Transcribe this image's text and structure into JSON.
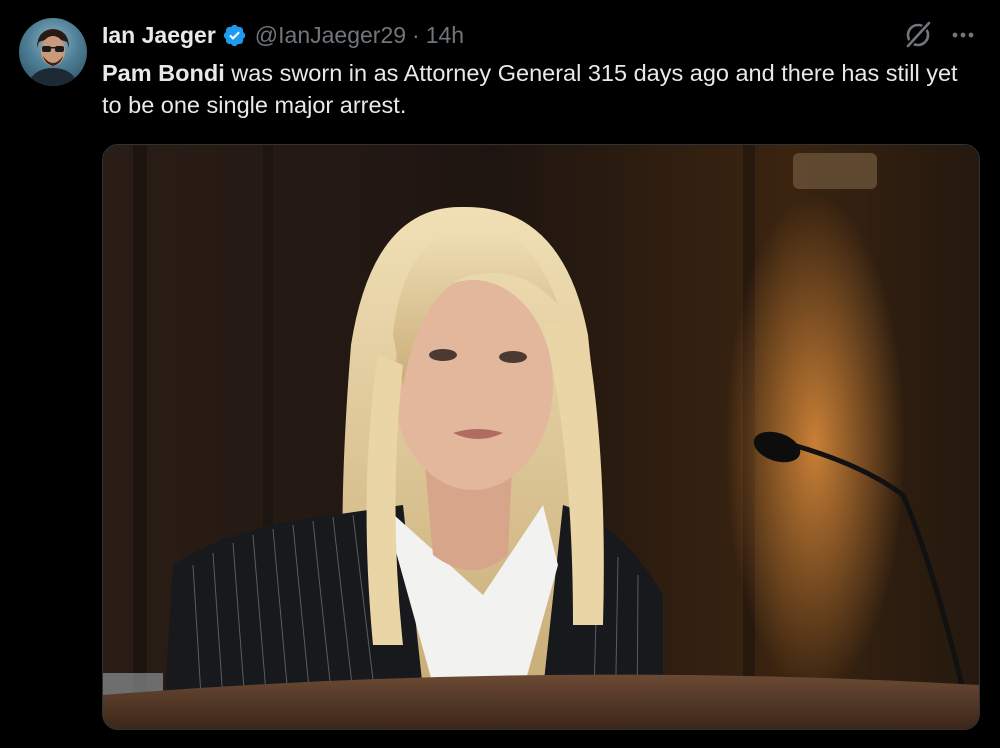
{
  "author": {
    "name": "Ian Jaeger",
    "handle": "@IanJaeger29",
    "separator": "·",
    "time": "14h",
    "verified": true,
    "avatar_icon": "avatar-photo"
  },
  "post": {
    "mention": "Pam Bondi",
    "text": " was sworn in as Attorney General 315 days ago and there has still yet to be one single major arrest."
  },
  "icons": {
    "verified": "verified-badge-icon",
    "grok": "grok-icon",
    "more": "more-options-icon"
  },
  "colors": {
    "background": "#000000",
    "text_primary": "#e7e9ea",
    "text_secondary": "#71767b",
    "verified_blue": "#1d9bf0",
    "media_border": "#2f3336"
  }
}
